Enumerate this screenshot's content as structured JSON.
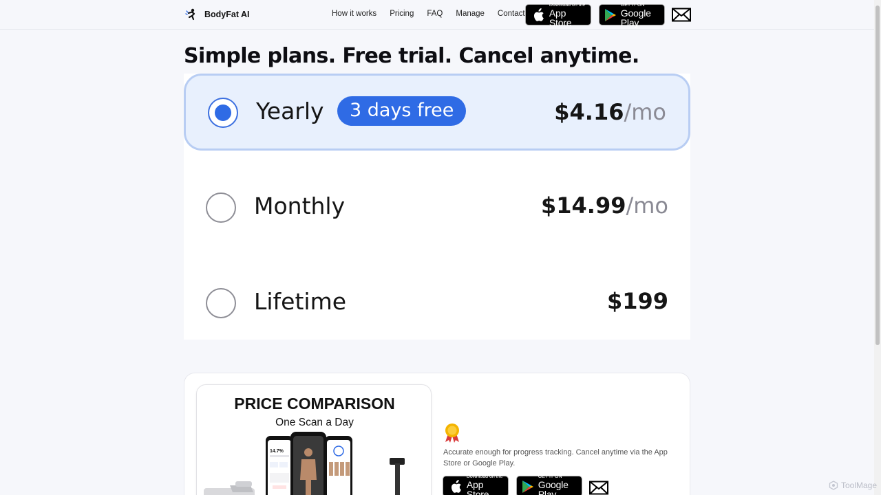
{
  "brand": {
    "name": "BodyFat AI"
  },
  "nav": {
    "links": [
      "How it works",
      "Pricing",
      "FAQ",
      "Manage",
      "Contact"
    ],
    "app_store": {
      "small": "Download on the",
      "big": "App Store"
    },
    "google_play": {
      "small": "GET IT ON",
      "big": "Google Play"
    }
  },
  "headline": "Simple plans. Free trial. Cancel anytime.",
  "plans": [
    {
      "name": "Yearly",
      "badge": "3 days free",
      "price": "$4.16",
      "unit": "/mo",
      "selected": true
    },
    {
      "name": "Monthly",
      "price": "$14.99",
      "unit": "/mo",
      "selected": false
    },
    {
      "name": "Lifetime",
      "price": "$199",
      "unit": "",
      "selected": false
    }
  ],
  "comparison": {
    "title": "PRICE COMPARISON",
    "subtitle": "One Scan a Day",
    "phone_value": "14.7%"
  },
  "card": {
    "text": "Accurate enough for progress tracking. Cancel anytime via the App Store or Google Play.",
    "app_store": {
      "small": "Download on the",
      "big": "App Store"
    },
    "google_play": {
      "small": "GET IT ON",
      "big": "Google Play"
    }
  },
  "watermark": "ToolMage",
  "colors": {
    "accent": "#2f6be5",
    "selected_bg": "#e8f0fd",
    "selected_border": "#b8cdf3"
  }
}
